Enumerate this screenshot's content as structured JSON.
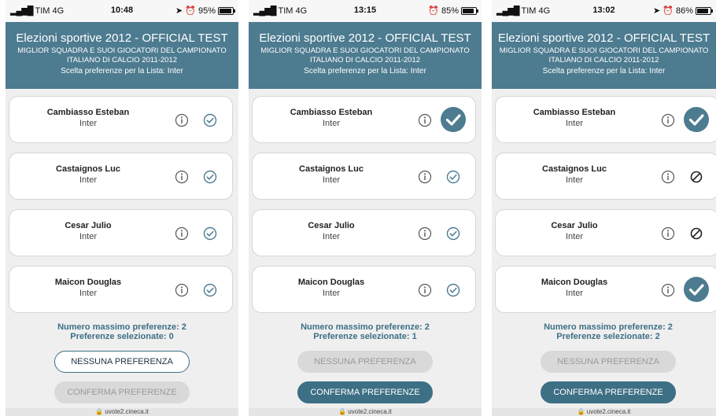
{
  "screens": [
    {
      "status": {
        "carrier": "TIM 4G",
        "time": "10:48",
        "battery": "95%",
        "battery_level": 0.95,
        "location": true
      },
      "header": {
        "title": "Elezioni sportive 2012 - OFFICIAL TEST",
        "subtitle1": "MIGLIOR SQUADRA E SUOI GIOCATORI DEL CAMPIONATO",
        "subtitle2": "ITALIANO DI CALCIO 2011-2012",
        "list_line": "Scelta preferenze per la Lista: Inter"
      },
      "players": [
        {
          "name": "Cambiasso Esteban",
          "team": "Inter",
          "state": "unselected"
        },
        {
          "name": "Castaignos Luc",
          "team": "Inter",
          "state": "unselected"
        },
        {
          "name": "Cesar Julio",
          "team": "Inter",
          "state": "unselected"
        },
        {
          "name": "Maicon Douglas",
          "team": "Inter",
          "state": "unselected"
        }
      ],
      "footer": {
        "max_pref": "Numero massimo preferenze: 2",
        "selected": "Preferenze selezionate: 0",
        "none_label": "NESSUNA PREFERENZA",
        "none_state": "outline",
        "confirm_label": "CONFERMA PREFERENZE",
        "confirm_state": "disabled"
      },
      "url": "uvote2.cineca.it"
    },
    {
      "status": {
        "carrier": "TIM 4G",
        "time": "13:15",
        "battery": "85%",
        "battery_level": 0.85,
        "location": false
      },
      "header": {
        "title": "Elezioni sportive 2012 - OFFICIAL TEST",
        "subtitle1": "MIGLIOR SQUADRA E SUOI GIOCATORI DEL CAMPIONATO",
        "subtitle2": "ITALIANO DI CALCIO 2011-2012",
        "list_line": "Scelta preferenze per la Lista: Inter"
      },
      "players": [
        {
          "name": "Cambiasso Esteban",
          "team": "Inter",
          "state": "selected"
        },
        {
          "name": "Castaignos Luc",
          "team": "Inter",
          "state": "unselected"
        },
        {
          "name": "Cesar Julio",
          "team": "Inter",
          "state": "unselected"
        },
        {
          "name": "Maicon Douglas",
          "team": "Inter",
          "state": "unselected"
        }
      ],
      "footer": {
        "max_pref": "Numero massimo preferenze: 2",
        "selected": "Preferenze selezionate: 1",
        "none_label": "NESSUNA PREFERENZA",
        "none_state": "disabled",
        "confirm_label": "CONFERMA PREFERENZE",
        "confirm_state": "primary"
      },
      "url": "uvote2.cineca.it"
    },
    {
      "status": {
        "carrier": "TIM 4G",
        "time": "13:02",
        "battery": "86%",
        "battery_level": 0.86,
        "location": true
      },
      "header": {
        "title": "Elezioni sportive 2012 - OFFICIAL TEST",
        "subtitle1": "MIGLIOR SQUADRA E SUOI GIOCATORI DEL CAMPIONATO",
        "subtitle2": "ITALIANO DI CALCIO 2011-2012",
        "list_line": "Scelta preferenze per la Lista: Inter"
      },
      "players": [
        {
          "name": "Cambiasso Esteban",
          "team": "Inter",
          "state": "selected"
        },
        {
          "name": "Castaignos Luc",
          "team": "Inter",
          "state": "blocked"
        },
        {
          "name": "Cesar Julio",
          "team": "Inter",
          "state": "blocked"
        },
        {
          "name": "Maicon Douglas",
          "team": "Inter",
          "state": "selected"
        }
      ],
      "footer": {
        "max_pref": "Numero massimo preferenze: 2",
        "selected": "Preferenze selezionate: 2",
        "none_label": "NESSUNA PREFERENZA",
        "none_state": "disabled",
        "confirm_label": "CONFERMA PREFERENZE",
        "confirm_state": "primary"
      },
      "url": "uvote2.cineca.it"
    }
  ],
  "colors": {
    "header": "#4d7b90",
    "accent": "#3d6f85",
    "check": "#4d7b90",
    "disabled": "#d9d9d9"
  },
  "icons": {
    "info": "info-icon",
    "unselected": "check-circle-outline-icon",
    "selected": "check-circle-filled-icon",
    "blocked": "prohibited-icon"
  }
}
